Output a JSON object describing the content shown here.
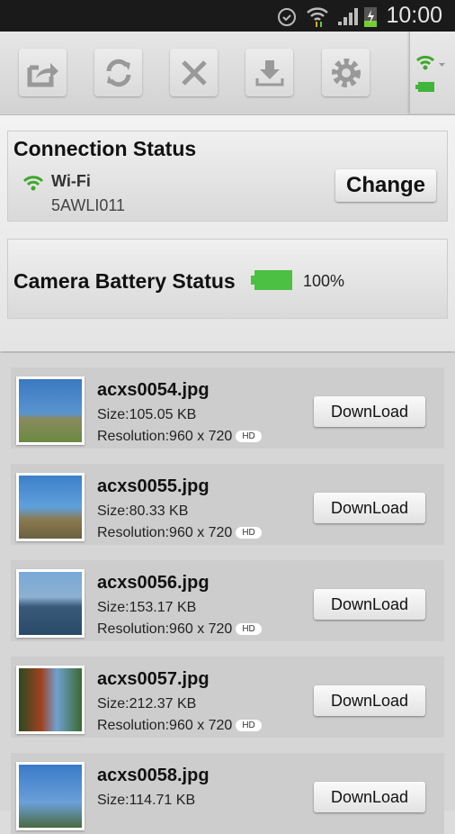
{
  "status_bar": {
    "time": "10:00",
    "icons": [
      "alarm-icon",
      "wifi-icon",
      "signal-icon",
      "battery-charging-icon"
    ]
  },
  "toolbar": {
    "buttons": [
      "share-icon",
      "refresh-icon",
      "close-icon",
      "download-icon",
      "settings-icon"
    ],
    "indicator": {
      "wifi_color": "#3fa82c",
      "battery_color": "#3fb53a"
    }
  },
  "connection": {
    "title": "Connection Status",
    "type": "Wi-Fi",
    "ssid": "5AWLI011",
    "change_label": "Change"
  },
  "battery": {
    "title": "Camera Battery Status",
    "percent_label": "100%",
    "level": 100,
    "color": "#4cc043"
  },
  "files": [
    {
      "name": "acxs0054.jpg",
      "size": "Size:105.05 KB",
      "resolution": "Resolution:960 x 720",
      "badge": "HD",
      "button": "DownLoad"
    },
    {
      "name": "acxs0055.jpg",
      "size": "Size:80.33 KB",
      "resolution": "Resolution:960 x 720",
      "badge": "HD",
      "button": "DownLoad"
    },
    {
      "name": "acxs0056.jpg",
      "size": "Size:153.17 KB",
      "resolution": "Resolution:960 x 720",
      "badge": "HD",
      "button": "DownLoad"
    },
    {
      "name": "acxs0057.jpg",
      "size": "Size:212.37 KB",
      "resolution": "Resolution:960 x 720",
      "badge": "HD",
      "button": "DownLoad"
    },
    {
      "name": "acxs0058.jpg",
      "size": "Size:114.71 KB",
      "resolution": "",
      "badge": "",
      "button": "DownLoad"
    }
  ]
}
